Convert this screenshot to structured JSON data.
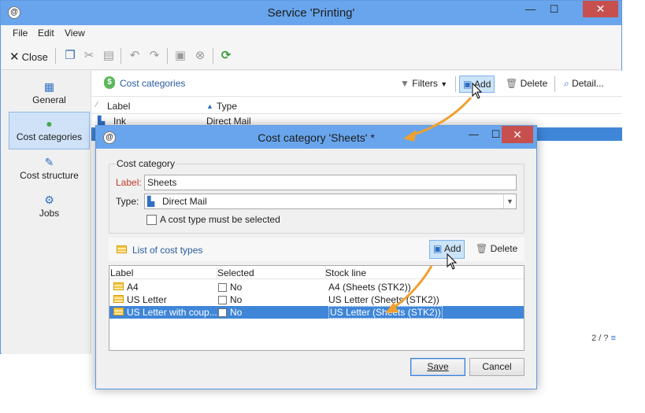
{
  "main": {
    "title": "Service 'Printing'",
    "menu": [
      "File",
      "Edit",
      "View"
    ],
    "toolbar": {
      "close_label": "Close"
    },
    "nav": [
      {
        "label": "General",
        "icon": "clipboard-icon"
      },
      {
        "label": "Cost categories",
        "icon": "money-icon",
        "selected": true
      },
      {
        "label": "Cost structure",
        "icon": "edit-icon"
      },
      {
        "label": "Jobs",
        "icon": "gears-icon"
      }
    ],
    "pane": {
      "title": "Cost categories",
      "buttons": {
        "filters": "Filters",
        "add": "Add",
        "delete": "Delete",
        "detail": "Detail..."
      },
      "columns": [
        "Label",
        "Type"
      ],
      "rows": [
        {
          "label": "Ink",
          "type": "Direct Mail"
        }
      ],
      "paging": "2 / ?"
    }
  },
  "dialog": {
    "title": "Cost category 'Sheets' *",
    "group_label": "Cost category",
    "label_field": {
      "label": "Label:",
      "value": "Sheets"
    },
    "type_field": {
      "label": "Type:",
      "value": "Direct Mail"
    },
    "checkbox_label": "A cost type must be selected",
    "list": {
      "title": "List of cost types",
      "add": "Add",
      "delete": "Delete",
      "columns": [
        "Label",
        "Selected",
        "Stock line"
      ],
      "rows": [
        {
          "label": "A4",
          "selected": "No",
          "stock": "A4 (Sheets (STK2))"
        },
        {
          "label": "US Letter",
          "selected": "No",
          "stock": "US Letter (Sheets (STK2))"
        },
        {
          "label": "US Letter with coup...",
          "selected": "No",
          "stock": "US Letter (Sheets (STK2))"
        }
      ]
    },
    "buttons": {
      "save": "Save",
      "cancel": "Cancel"
    }
  },
  "colors": {
    "titlebar": "#68a5ec",
    "close": "#c7504f",
    "selection": "#3f86d8",
    "arrow": "#f0a030",
    "link": "#2a5d9f"
  }
}
